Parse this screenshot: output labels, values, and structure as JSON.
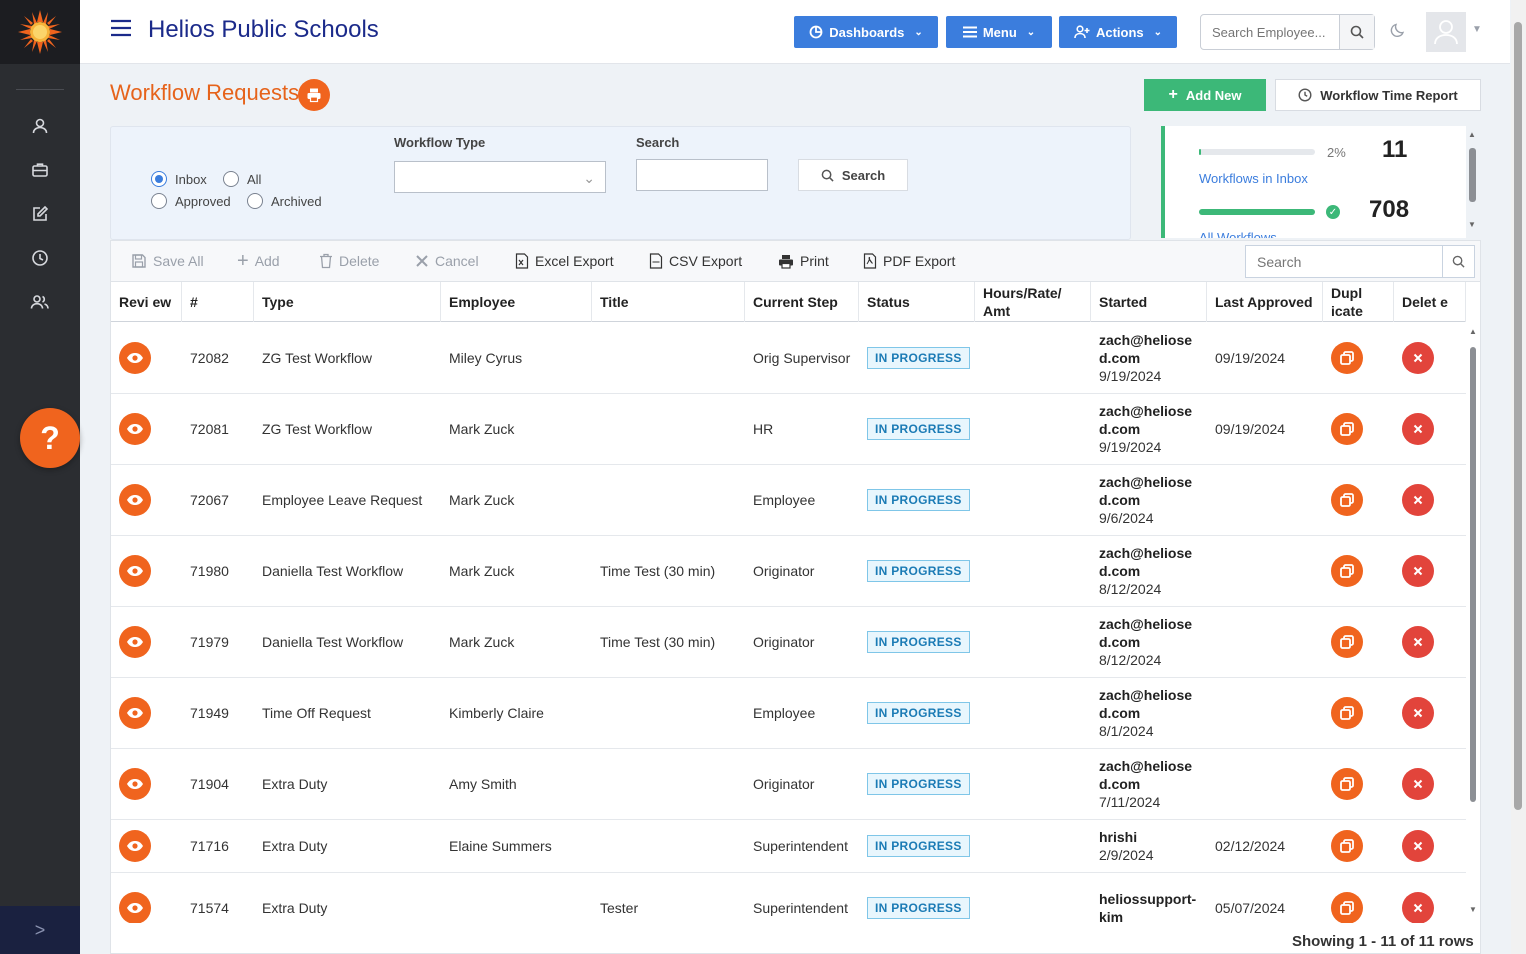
{
  "app": {
    "title": "Helios Public Schools",
    "colors": {
      "brand_blue": "#1b2a8a",
      "accent_orange": "#f0641e",
      "button_blue": "#3b7ddd",
      "green": "#3cb878",
      "sidebar": "#2b2d31"
    }
  },
  "sidebar": {
    "items": [
      {
        "icon": "user-icon"
      },
      {
        "icon": "briefcase-icon"
      },
      {
        "icon": "edit-icon"
      },
      {
        "icon": "clock-icon"
      },
      {
        "icon": "users-icon"
      }
    ],
    "help_label": "?",
    "collapse_label": ">"
  },
  "topbar": {
    "dashboards_label": "Dashboards",
    "menu_label": "Menu",
    "actions_label": "Actions",
    "search_placeholder": "Search Employee..."
  },
  "page": {
    "title": "Workflow Requests",
    "add_new_label": "Add New",
    "time_report_label": "Workflow Time Report"
  },
  "filter": {
    "radios": {
      "inbox": "Inbox",
      "all": "All",
      "approved": "Approved",
      "archived": "Archived"
    },
    "selected": "Inbox",
    "workflow_type_label": "Workflow Type",
    "workflow_type_value": "",
    "search_label": "Search",
    "search_value": "",
    "search_button": "Search"
  },
  "stats": {
    "inbox_pct_label": "2%",
    "inbox_fraction": 0.02,
    "inbox_count": "11",
    "inbox_link": "Workflows in Inbox",
    "all_fraction": 1.0,
    "all_count": "708",
    "all_link": "All Workflows"
  },
  "toolbar": {
    "save_all": "Save All",
    "add": "Add",
    "delete": "Delete",
    "cancel": "Cancel",
    "excel": "Excel Export",
    "csv": "CSV Export",
    "print": "Print",
    "pdf": "PDF Export",
    "search_placeholder": "Search"
  },
  "columns": [
    {
      "key": "review",
      "label": "Revi ew"
    },
    {
      "key": "num",
      "label": "#"
    },
    {
      "key": "type",
      "label": "Type"
    },
    {
      "key": "employee",
      "label": "Employee"
    },
    {
      "key": "title",
      "label": "Title"
    },
    {
      "key": "step",
      "label": "Current Step"
    },
    {
      "key": "status",
      "label": "Status"
    },
    {
      "key": "hours",
      "label": "Hours/Rate/ Amt"
    },
    {
      "key": "started",
      "label": "Started"
    },
    {
      "key": "last",
      "label": "Last Approved"
    },
    {
      "key": "dup",
      "label": "Dupl icate"
    },
    {
      "key": "del",
      "label": "Delet e"
    }
  ],
  "rows": [
    {
      "num": "72082",
      "type": "ZG Test Workflow",
      "employee": "Miley Cyrus",
      "title": "",
      "step": "Orig Supervisor",
      "status": "IN PROGRESS",
      "hours": "",
      "started_by": "zach@heliose d.com",
      "started_date": "9/19/2024",
      "last": "09/19/2024"
    },
    {
      "num": "72081",
      "type": "ZG Test Workflow",
      "employee": "Mark Zuck",
      "title": "",
      "step": "HR",
      "status": "IN PROGRESS",
      "hours": "",
      "started_by": "zach@heliose d.com",
      "started_date": "9/19/2024",
      "last": "09/19/2024"
    },
    {
      "num": "72067",
      "type": "Employee Leave Request",
      "employee": "Mark Zuck",
      "title": "",
      "step": "Employee",
      "status": "IN PROGRESS",
      "hours": "",
      "started_by": "zach@heliose d.com",
      "started_date": "9/6/2024",
      "last": ""
    },
    {
      "num": "71980",
      "type": "Daniella Test Workflow",
      "employee": "Mark Zuck",
      "title": "Time Test (30 min)",
      "step": "Originator",
      "status": "IN PROGRESS",
      "hours": "",
      "started_by": "zach@heliose d.com",
      "started_date": "8/12/2024",
      "last": ""
    },
    {
      "num": "71979",
      "type": "Daniella Test Workflow",
      "employee": "Mark Zuck",
      "title": "Time Test (30 min)",
      "step": "Originator",
      "status": "IN PROGRESS",
      "hours": "",
      "started_by": "zach@heliose d.com",
      "started_date": "8/12/2024",
      "last": ""
    },
    {
      "num": "71949",
      "type": "Time Off Request",
      "employee": "Kimberly Claire",
      "title": "",
      "step": "Employee",
      "status": "IN PROGRESS",
      "hours": "",
      "started_by": "zach@heliose d.com",
      "started_date": "8/1/2024",
      "last": ""
    },
    {
      "num": "71904",
      "type": "Extra Duty",
      "employee": "Amy Smith",
      "title": "",
      "step": "Originator",
      "status": "IN PROGRESS",
      "hours": "",
      "started_by": "zach@heliose d.com",
      "started_date": "7/11/2024",
      "last": ""
    },
    {
      "num": "71716",
      "type": "Extra Duty",
      "employee": "Elaine Summers",
      "title": "",
      "step": "Superintendent",
      "status": "IN PROGRESS",
      "hours": "",
      "started_by": "hrishi",
      "started_date": "2/9/2024",
      "last": "02/12/2024"
    },
    {
      "num": "71574",
      "type": "Extra Duty",
      "employee": "",
      "title": "Tester",
      "step": "Superintendent",
      "status": "IN PROGRESS",
      "hours": "",
      "started_by": "heliossupport- kim",
      "started_date": "",
      "last": "05/07/2024"
    }
  ],
  "footer": {
    "showing": "Showing 1 - 11 of 11 rows"
  }
}
